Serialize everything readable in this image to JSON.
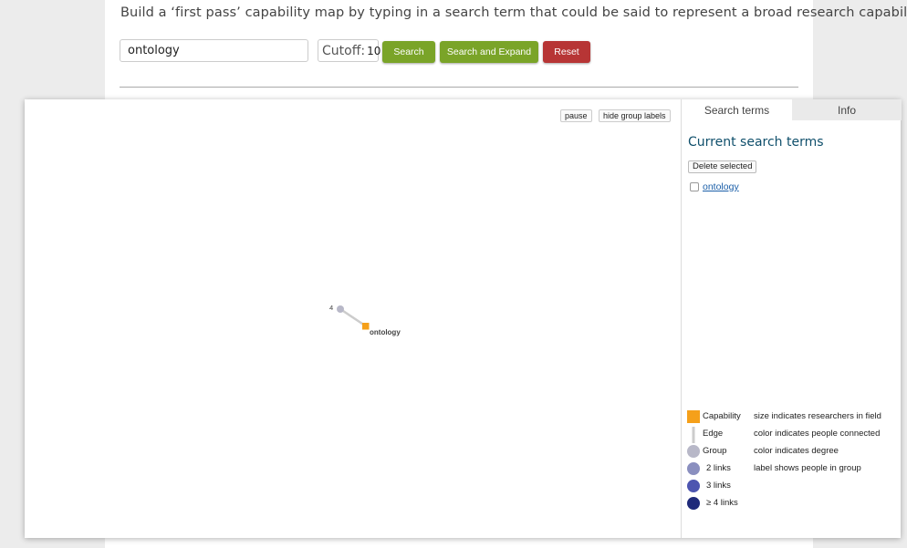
{
  "intro_text": "Build a ‘first pass’ capability map by typing in a search term that could be said to represent a broad research capability.",
  "search": {
    "value": "ontology"
  },
  "cutoff": {
    "label": "Cutoff:",
    "value": "10"
  },
  "buttons": {
    "search": "Search",
    "search_expand": "Search and Expand",
    "reset": "Reset"
  },
  "graph": {
    "controls": {
      "pause": "pause",
      "hide_labels": "hide group labels"
    },
    "nodes": {
      "group": {
        "label": "4",
        "color": "#b8b8c8"
      },
      "capability": {
        "label": "ontology",
        "color": "#f5a01a"
      }
    },
    "edge_color": "#cccccc"
  },
  "sidebar": {
    "tabs": [
      "Search terms",
      "Info"
    ],
    "title": "Current search terms",
    "delete_label": "Delete selected",
    "terms": [
      "ontology"
    ]
  },
  "legend": [
    {
      "icon": "square",
      "color": "#f5a01a",
      "label": "Capability",
      "desc": "size indicates researchers in field"
    },
    {
      "icon": "edge",
      "color": "#cccccc",
      "label": "Edge",
      "desc": "color indicates people connected"
    },
    {
      "icon": "circle",
      "color": "#b8b8c8",
      "label": "Group",
      "desc": "color indicates degree"
    },
    {
      "icon": "circle",
      "color": "#8a8fbf",
      "label": "2 links",
      "desc": "label shows people in group"
    },
    {
      "icon": "circle",
      "color": "#4d55b0",
      "label": "3 links",
      "desc": ""
    },
    {
      "icon": "circle",
      "color": "#1f2a7a",
      "label": "≥ 4 links",
      "desc": ""
    }
  ]
}
